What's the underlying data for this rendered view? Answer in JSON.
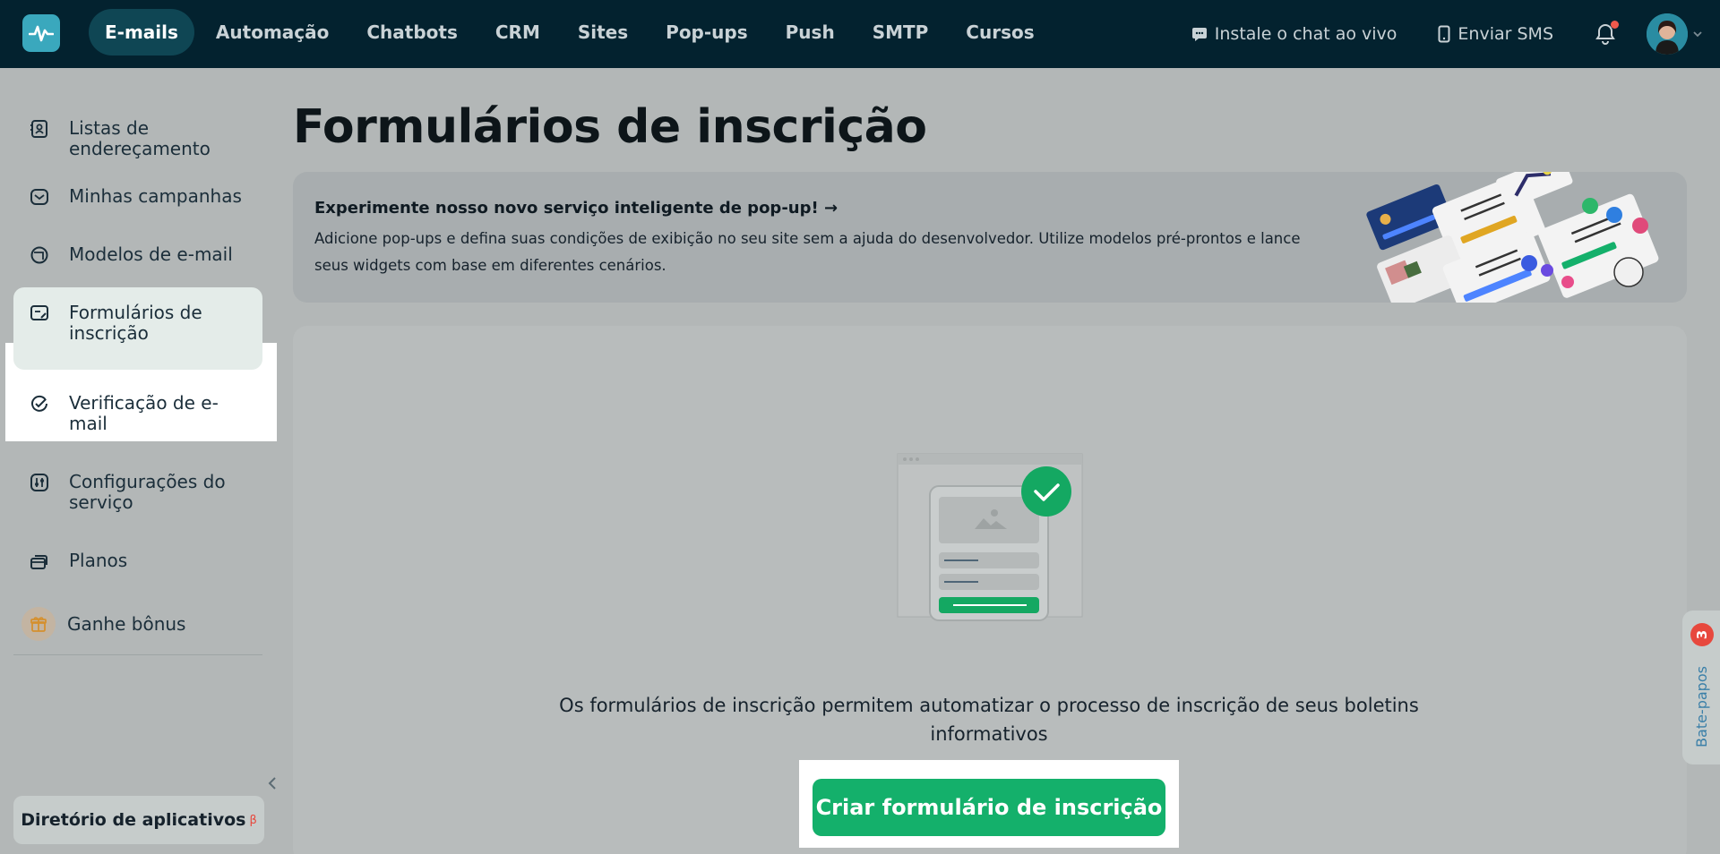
{
  "topbar": {
    "nav": [
      {
        "label": "E-mails",
        "active": true
      },
      {
        "label": "Automação"
      },
      {
        "label": "Chatbots"
      },
      {
        "label": "CRM"
      },
      {
        "label": "Sites"
      },
      {
        "label": "Pop-ups"
      },
      {
        "label": "Push"
      },
      {
        "label": "SMTP"
      },
      {
        "label": "Cursos"
      }
    ],
    "live_chat_label": "Instale o chat ao vivo",
    "sms_label": "Enviar SMS"
  },
  "sidebar": {
    "items": [
      {
        "label": "Listas de endereçamento",
        "icon": "contacts-icon"
      },
      {
        "label": "Minhas campanhas",
        "icon": "campaign-icon"
      },
      {
        "label": "Modelos de e-mail",
        "icon": "template-icon"
      },
      {
        "label": "Formulários de inscrição",
        "icon": "form-icon",
        "active": true
      },
      {
        "label": "Verificação de e-mail",
        "icon": "check-circle-icon"
      },
      {
        "label": "Configurações do serviço",
        "icon": "settings-sliders-icon"
      },
      {
        "label": "Planos",
        "icon": "plans-icon"
      }
    ],
    "bonus_label": "Ganhe bônus",
    "app_directory_label": "Diretório de aplicativos",
    "app_directory_badge": "β"
  },
  "main": {
    "title": "Formulários de inscrição",
    "banner": {
      "title": "Experimente nosso novo serviço inteligente de pop-up! →",
      "text": "Adicione pop-ups e defina suas condições de exibição no seu site sem a ajuda do desenvolvedor. Utilize modelos pré-prontos e lance seus widgets com base em diferentes cenários."
    },
    "empty_text": "Os formulários de inscrição permitem automatizar o processo de inscrição de seus boletins informativos",
    "cta_label": "Criar formulário de inscrição"
  },
  "chat_tab": {
    "label": "Bate-papos",
    "count": "3"
  },
  "colors": {
    "topbar": "#03222f",
    "accent_green": "#14b06b",
    "badge_red": "#e7483d"
  }
}
